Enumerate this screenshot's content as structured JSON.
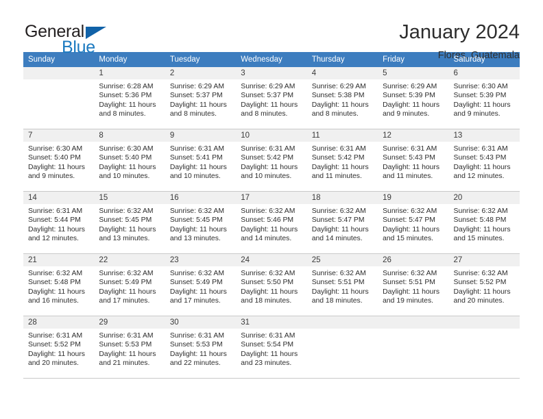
{
  "brand": {
    "word_one": "General",
    "word_two": "Blue",
    "flag_icon": "triangle-flag-icon"
  },
  "header": {
    "title": "January 2024",
    "location": "Flores, Guatemala"
  },
  "calendar": {
    "weekday_headers": [
      "Sunday",
      "Monday",
      "Tuesday",
      "Wednesday",
      "Thursday",
      "Friday",
      "Saturday"
    ],
    "accent_color": "#3d7dbf",
    "daynum_bg": "#f0f0f0",
    "weeks": [
      [
        {
          "day": "",
          "sunrise": "",
          "sunset": "",
          "daylight_line1": "",
          "daylight_line2": ""
        },
        {
          "day": "1",
          "sunrise": "Sunrise: 6:28 AM",
          "sunset": "Sunset: 5:36 PM",
          "daylight_line1": "Daylight: 11 hours",
          "daylight_line2": "and 8 minutes."
        },
        {
          "day": "2",
          "sunrise": "Sunrise: 6:29 AM",
          "sunset": "Sunset: 5:37 PM",
          "daylight_line1": "Daylight: 11 hours",
          "daylight_line2": "and 8 minutes."
        },
        {
          "day": "3",
          "sunrise": "Sunrise: 6:29 AM",
          "sunset": "Sunset: 5:37 PM",
          "daylight_line1": "Daylight: 11 hours",
          "daylight_line2": "and 8 minutes."
        },
        {
          "day": "4",
          "sunrise": "Sunrise: 6:29 AM",
          "sunset": "Sunset: 5:38 PM",
          "daylight_line1": "Daylight: 11 hours",
          "daylight_line2": "and 8 minutes."
        },
        {
          "day": "5",
          "sunrise": "Sunrise: 6:29 AM",
          "sunset": "Sunset: 5:39 PM",
          "daylight_line1": "Daylight: 11 hours",
          "daylight_line2": "and 9 minutes."
        },
        {
          "day": "6",
          "sunrise": "Sunrise: 6:30 AM",
          "sunset": "Sunset: 5:39 PM",
          "daylight_line1": "Daylight: 11 hours",
          "daylight_line2": "and 9 minutes."
        }
      ],
      [
        {
          "day": "7",
          "sunrise": "Sunrise: 6:30 AM",
          "sunset": "Sunset: 5:40 PM",
          "daylight_line1": "Daylight: 11 hours",
          "daylight_line2": "and 9 minutes."
        },
        {
          "day": "8",
          "sunrise": "Sunrise: 6:30 AM",
          "sunset": "Sunset: 5:40 PM",
          "daylight_line1": "Daylight: 11 hours",
          "daylight_line2": "and 10 minutes."
        },
        {
          "day": "9",
          "sunrise": "Sunrise: 6:31 AM",
          "sunset": "Sunset: 5:41 PM",
          "daylight_line1": "Daylight: 11 hours",
          "daylight_line2": "and 10 minutes."
        },
        {
          "day": "10",
          "sunrise": "Sunrise: 6:31 AM",
          "sunset": "Sunset: 5:42 PM",
          "daylight_line1": "Daylight: 11 hours",
          "daylight_line2": "and 10 minutes."
        },
        {
          "day": "11",
          "sunrise": "Sunrise: 6:31 AM",
          "sunset": "Sunset: 5:42 PM",
          "daylight_line1": "Daylight: 11 hours",
          "daylight_line2": "and 11 minutes."
        },
        {
          "day": "12",
          "sunrise": "Sunrise: 6:31 AM",
          "sunset": "Sunset: 5:43 PM",
          "daylight_line1": "Daylight: 11 hours",
          "daylight_line2": "and 11 minutes."
        },
        {
          "day": "13",
          "sunrise": "Sunrise: 6:31 AM",
          "sunset": "Sunset: 5:43 PM",
          "daylight_line1": "Daylight: 11 hours",
          "daylight_line2": "and 12 minutes."
        }
      ],
      [
        {
          "day": "14",
          "sunrise": "Sunrise: 6:31 AM",
          "sunset": "Sunset: 5:44 PM",
          "daylight_line1": "Daylight: 11 hours",
          "daylight_line2": "and 12 minutes."
        },
        {
          "day": "15",
          "sunrise": "Sunrise: 6:32 AM",
          "sunset": "Sunset: 5:45 PM",
          "daylight_line1": "Daylight: 11 hours",
          "daylight_line2": "and 13 minutes."
        },
        {
          "day": "16",
          "sunrise": "Sunrise: 6:32 AM",
          "sunset": "Sunset: 5:45 PM",
          "daylight_line1": "Daylight: 11 hours",
          "daylight_line2": "and 13 minutes."
        },
        {
          "day": "17",
          "sunrise": "Sunrise: 6:32 AM",
          "sunset": "Sunset: 5:46 PM",
          "daylight_line1": "Daylight: 11 hours",
          "daylight_line2": "and 14 minutes."
        },
        {
          "day": "18",
          "sunrise": "Sunrise: 6:32 AM",
          "sunset": "Sunset: 5:47 PM",
          "daylight_line1": "Daylight: 11 hours",
          "daylight_line2": "and 14 minutes."
        },
        {
          "day": "19",
          "sunrise": "Sunrise: 6:32 AM",
          "sunset": "Sunset: 5:47 PM",
          "daylight_line1": "Daylight: 11 hours",
          "daylight_line2": "and 15 minutes."
        },
        {
          "day": "20",
          "sunrise": "Sunrise: 6:32 AM",
          "sunset": "Sunset: 5:48 PM",
          "daylight_line1": "Daylight: 11 hours",
          "daylight_line2": "and 15 minutes."
        }
      ],
      [
        {
          "day": "21",
          "sunrise": "Sunrise: 6:32 AM",
          "sunset": "Sunset: 5:48 PM",
          "daylight_line1": "Daylight: 11 hours",
          "daylight_line2": "and 16 minutes."
        },
        {
          "day": "22",
          "sunrise": "Sunrise: 6:32 AM",
          "sunset": "Sunset: 5:49 PM",
          "daylight_line1": "Daylight: 11 hours",
          "daylight_line2": "and 17 minutes."
        },
        {
          "day": "23",
          "sunrise": "Sunrise: 6:32 AM",
          "sunset": "Sunset: 5:49 PM",
          "daylight_line1": "Daylight: 11 hours",
          "daylight_line2": "and 17 minutes."
        },
        {
          "day": "24",
          "sunrise": "Sunrise: 6:32 AM",
          "sunset": "Sunset: 5:50 PM",
          "daylight_line1": "Daylight: 11 hours",
          "daylight_line2": "and 18 minutes."
        },
        {
          "day": "25",
          "sunrise": "Sunrise: 6:32 AM",
          "sunset": "Sunset: 5:51 PM",
          "daylight_line1": "Daylight: 11 hours",
          "daylight_line2": "and 18 minutes."
        },
        {
          "day": "26",
          "sunrise": "Sunrise: 6:32 AM",
          "sunset": "Sunset: 5:51 PM",
          "daylight_line1": "Daylight: 11 hours",
          "daylight_line2": "and 19 minutes."
        },
        {
          "day": "27",
          "sunrise": "Sunrise: 6:32 AM",
          "sunset": "Sunset: 5:52 PM",
          "daylight_line1": "Daylight: 11 hours",
          "daylight_line2": "and 20 minutes."
        }
      ],
      [
        {
          "day": "28",
          "sunrise": "Sunrise: 6:31 AM",
          "sunset": "Sunset: 5:52 PM",
          "daylight_line1": "Daylight: 11 hours",
          "daylight_line2": "and 20 minutes."
        },
        {
          "day": "29",
          "sunrise": "Sunrise: 6:31 AM",
          "sunset": "Sunset: 5:53 PM",
          "daylight_line1": "Daylight: 11 hours",
          "daylight_line2": "and 21 minutes."
        },
        {
          "day": "30",
          "sunrise": "Sunrise: 6:31 AM",
          "sunset": "Sunset: 5:53 PM",
          "daylight_line1": "Daylight: 11 hours",
          "daylight_line2": "and 22 minutes."
        },
        {
          "day": "31",
          "sunrise": "Sunrise: 6:31 AM",
          "sunset": "Sunset: 5:54 PM",
          "daylight_line1": "Daylight: 11 hours",
          "daylight_line2": "and 23 minutes."
        },
        {
          "day": "",
          "sunrise": "",
          "sunset": "",
          "daylight_line1": "",
          "daylight_line2": ""
        },
        {
          "day": "",
          "sunrise": "",
          "sunset": "",
          "daylight_line1": "",
          "daylight_line2": ""
        },
        {
          "day": "",
          "sunrise": "",
          "sunset": "",
          "daylight_line1": "",
          "daylight_line2": ""
        }
      ]
    ]
  }
}
